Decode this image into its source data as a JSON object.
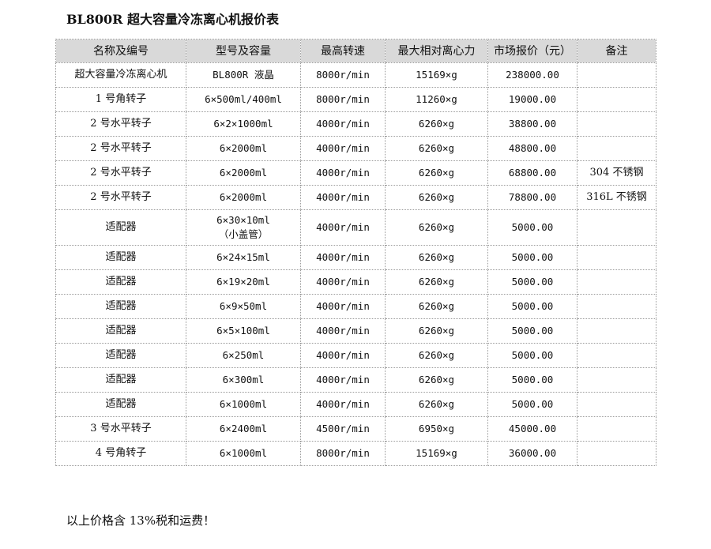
{
  "title": "BL800R 超大容量冷冻离心机报价表",
  "table": {
    "headers": [
      "名称及编号",
      "型号及容量",
      "最高转速",
      "最大相对离心力",
      "市场报价（元）",
      "备注"
    ],
    "rows": [
      {
        "name": "超大容量冷冻离心机",
        "model_line1": "BL800R 液晶",
        "model_line2": "",
        "speed": "8000r/min",
        "rcf": "15169×g",
        "price": "238000.00",
        "remark": ""
      },
      {
        "name": "1 号角转子",
        "model_line1": "6×500ml/400ml",
        "model_line2": "",
        "speed": "8000r/min",
        "rcf": "11260×g",
        "price": "19000.00",
        "remark": ""
      },
      {
        "name": "2 号水平转子",
        "model_line1": "6×2×1000ml",
        "model_line2": "",
        "speed": "4000r/min",
        "rcf": "6260×g",
        "price": "38800.00",
        "remark": ""
      },
      {
        "name": "2 号水平转子",
        "model_line1": "6×2000ml",
        "model_line2": "",
        "speed": "4000r/min",
        "rcf": "6260×g",
        "price": "48800.00",
        "remark": ""
      },
      {
        "name": "2 号水平转子",
        "model_line1": "6×2000ml",
        "model_line2": "",
        "speed": "4000r/min",
        "rcf": "6260×g",
        "price": "68800.00",
        "remark": "304 不锈钢"
      },
      {
        "name": "2 号水平转子",
        "model_line1": "6×2000ml",
        "model_line2": "",
        "speed": "4000r/min",
        "rcf": "6260×g",
        "price": "78800.00",
        "remark": "316L 不锈钢"
      },
      {
        "name": "适配器",
        "model_line1": "6×30×10ml",
        "model_line2": "（小盖管）",
        "speed": "4000r/min",
        "rcf": "6260×g",
        "price": "5000.00",
        "remark": ""
      },
      {
        "name": "适配器",
        "model_line1": "6×24×15ml",
        "model_line2": "",
        "speed": "4000r/min",
        "rcf": "6260×g",
        "price": "5000.00",
        "remark": ""
      },
      {
        "name": "适配器",
        "model_line1": "6×19×20ml",
        "model_line2": "",
        "speed": "4000r/min",
        "rcf": "6260×g",
        "price": "5000.00",
        "remark": ""
      },
      {
        "name": "适配器",
        "model_line1": "6×9×50ml",
        "model_line2": "",
        "speed": "4000r/min",
        "rcf": "6260×g",
        "price": "5000.00",
        "remark": ""
      },
      {
        "name": "适配器",
        "model_line1": "6×5×100ml",
        "model_line2": "",
        "speed": "4000r/min",
        "rcf": "6260×g",
        "price": "5000.00",
        "remark": ""
      },
      {
        "name": "适配器",
        "model_line1": "6×250ml",
        "model_line2": "",
        "speed": "4000r/min",
        "rcf": "6260×g",
        "price": "5000.00",
        "remark": ""
      },
      {
        "name": "适配器",
        "model_line1": "6×300ml",
        "model_line2": "",
        "speed": "4000r/min",
        "rcf": "6260×g",
        "price": "5000.00",
        "remark": ""
      },
      {
        "name": "适配器",
        "model_line1": "6×1000ml",
        "model_line2": "",
        "speed": "4000r/min",
        "rcf": "6260×g",
        "price": "5000.00",
        "remark": ""
      },
      {
        "name": "3 号水平转子",
        "model_line1": "6×2400ml",
        "model_line2": "",
        "speed": "4500r/min",
        "rcf": "6950×g",
        "price": "45000.00",
        "remark": ""
      },
      {
        "name": "4 号角转子",
        "model_line1": "6×1000ml",
        "model_line2": "",
        "speed": "8000r/min",
        "rcf": "15169×g",
        "price": "36000.00",
        "remark": ""
      }
    ]
  },
  "footnote": "以上价格含 13%税和运费！"
}
